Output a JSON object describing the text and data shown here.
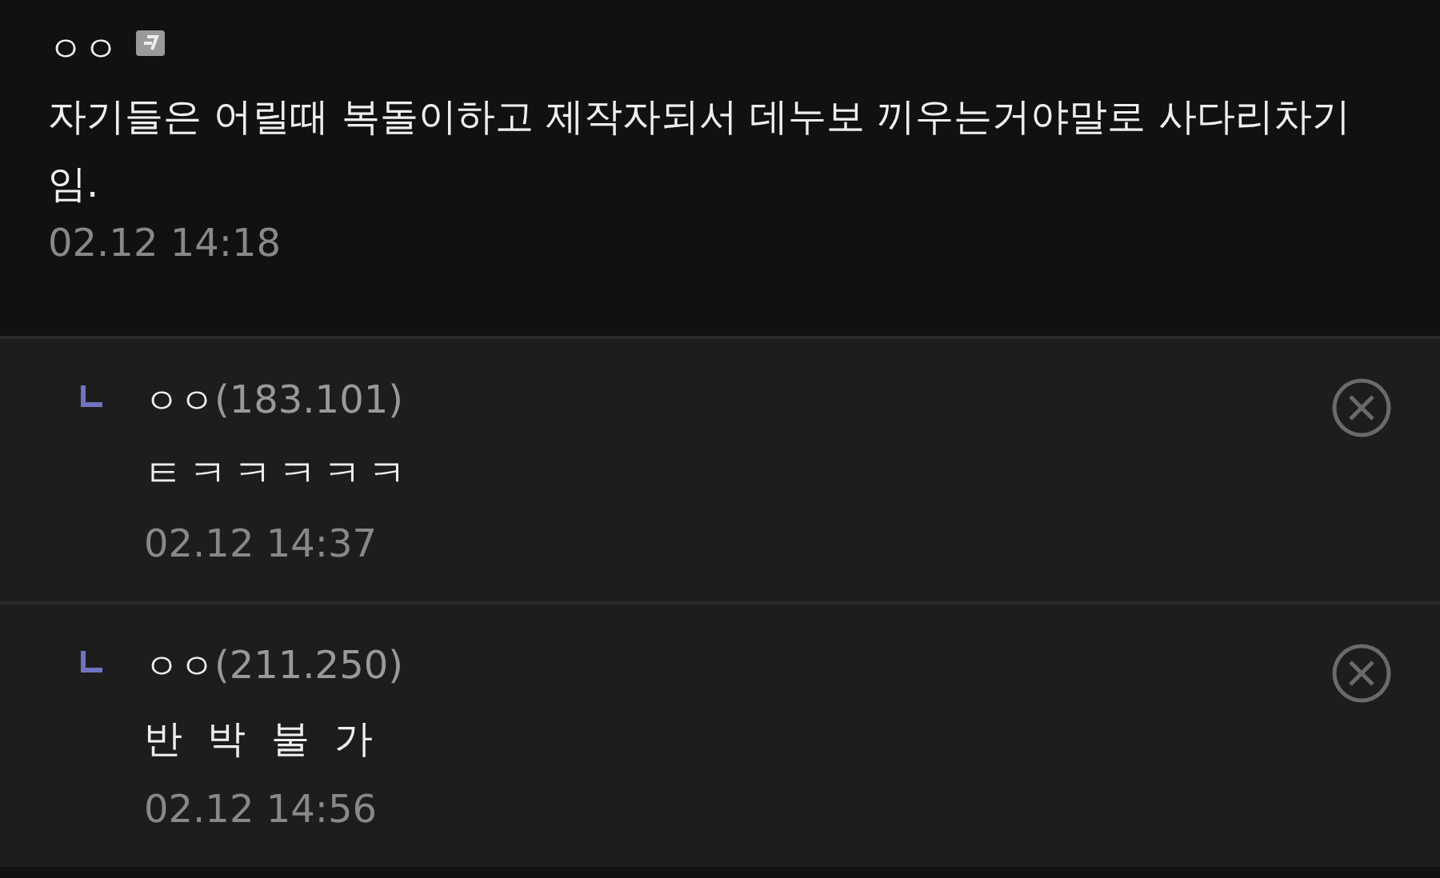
{
  "comment": {
    "author": "ㅇㅇ",
    "text": "자기들은 어릴때 복돌이하고 제작자되서 데누보 끼우는거야말로 사다리차기임.",
    "time": "02.12 14:18"
  },
  "replies": [
    {
      "author": "ㅇㅇ",
      "ip": "(183.101)",
      "text": "ㅌㅋㅋㅋㅋㅋ",
      "time": "02.12 14:37"
    },
    {
      "author": "ㅇㅇ",
      "ip": "(211.250)",
      "text": "반 박 불 가",
      "time": "02.12 14:56"
    }
  ]
}
